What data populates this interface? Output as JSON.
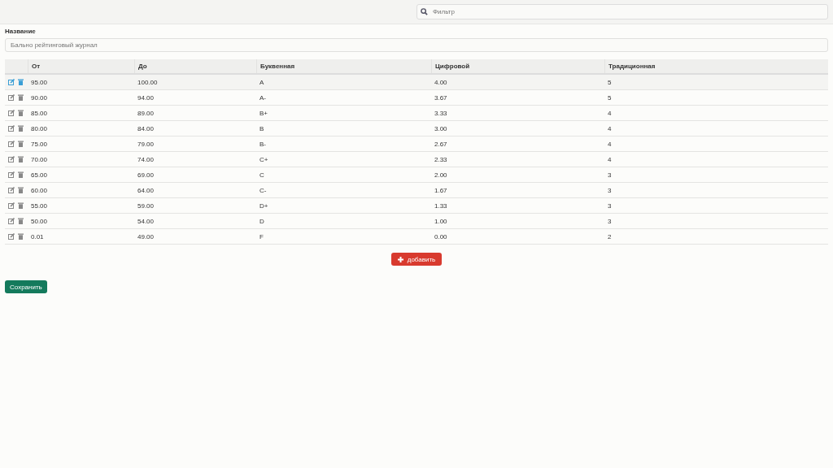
{
  "filter": {
    "placeholder": "Фильтр"
  },
  "name_field": {
    "label": "Название",
    "placeholder": "Бально рейтинговый журнал"
  },
  "table": {
    "columns": [
      "От",
      "До",
      "Буквенная",
      "Цифровой",
      "Традиционная"
    ],
    "rows": [
      {
        "hovered": true,
        "cells": [
          "95.00",
          "100.00",
          "A",
          "4.00",
          "5"
        ]
      },
      {
        "hovered": false,
        "cells": [
          "90.00",
          "94.00",
          "A-",
          "3.67",
          "5"
        ]
      },
      {
        "hovered": false,
        "cells": [
          "85.00",
          "89.00",
          "B+",
          "3.33",
          "4"
        ]
      },
      {
        "hovered": false,
        "cells": [
          "80.00",
          "84.00",
          "B",
          "3.00",
          "4"
        ]
      },
      {
        "hovered": false,
        "cells": [
          "75.00",
          "79.00",
          "B-",
          "2.67",
          "4"
        ]
      },
      {
        "hovered": false,
        "cells": [
          "70.00",
          "74.00",
          "C+",
          "2.33",
          "4"
        ]
      },
      {
        "hovered": false,
        "cells": [
          "65.00",
          "69.00",
          "C",
          "2.00",
          "3"
        ]
      },
      {
        "hovered": false,
        "cells": [
          "60.00",
          "64.00",
          "C-",
          "1.67",
          "3"
        ]
      },
      {
        "hovered": false,
        "cells": [
          "55.00",
          "59.00",
          "D+",
          "1.33",
          "3"
        ]
      },
      {
        "hovered": false,
        "cells": [
          "50.00",
          "54.00",
          "D",
          "1.00",
          "3"
        ]
      },
      {
        "hovered": false,
        "cells": [
          "0.01",
          "49.00",
          "F",
          "0.00",
          "2"
        ]
      }
    ]
  },
  "add_button": "добавить",
  "save_button": "Сохранить"
}
